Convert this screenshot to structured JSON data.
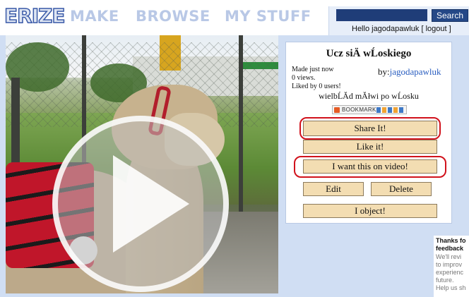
{
  "header": {
    "logo_text": "ERIZE",
    "nav": [
      {
        "label": "MAKE"
      },
      {
        "label": "BROWSE"
      },
      {
        "label": "MY STUFF"
      }
    ],
    "search": {
      "value": "",
      "button_label": "Search"
    },
    "greeting": {
      "prefix": "Hello ",
      "username": "jagodapawluk",
      "logout_label": "[ logout ]"
    }
  },
  "video": {
    "play_icon": "play-icon"
  },
  "panel": {
    "title": "Ucz siÄ wĹoskiego",
    "made": "Made just now",
    "views": "0 views.",
    "liked": "Liked by 0 users!",
    "by_prefix": "by:",
    "author": "jagodapawluk",
    "description": "wielbĹĂd mĂłwi po wĹosku",
    "bookmark_label": "BOOKMARK",
    "buttons": {
      "share": "Share It!",
      "like": "Like it!",
      "want_video": "I want this on video!",
      "edit": "Edit",
      "delete": "Delete",
      "object": "I object!"
    },
    "highlight_color": "#d1121c",
    "button_color": "#f3ddb2"
  },
  "feedback": {
    "line1": "Thanks fo",
    "line2": "feedback",
    "line3": "We'll revi",
    "line4": "to improv",
    "line5": "experienc",
    "line6": "future.",
    "line7": "Help us sh"
  },
  "colors": {
    "nav_text": "#b9c8e6",
    "page_band": "#d0def3",
    "search_box": "#1f3d78"
  }
}
